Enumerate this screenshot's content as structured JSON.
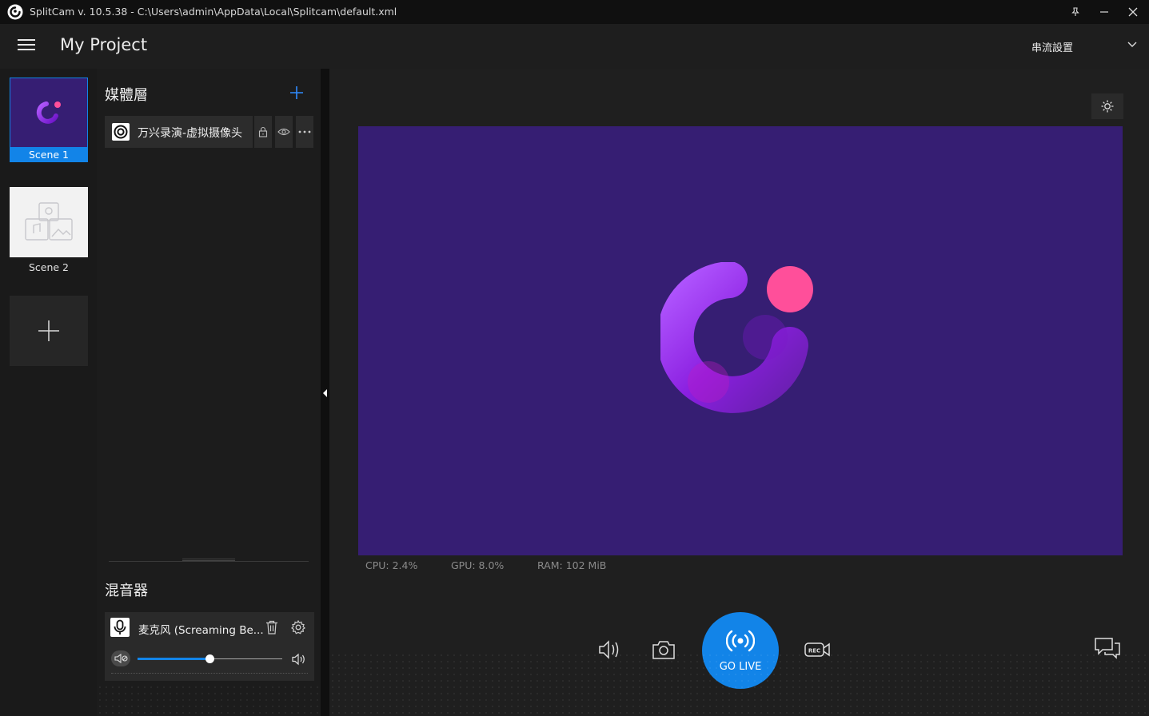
{
  "window": {
    "title": "SplitCam v. 10.5.38 - C:\\Users\\admin\\AppData\\Local\\Splitcam\\default.xml",
    "pin_icon": "pin-icon",
    "minimize_icon": "minimize-icon",
    "close_icon": "close-icon"
  },
  "header": {
    "project_name": "My Project",
    "stream_settings_label": "串流設置"
  },
  "scenes": [
    {
      "label": "Scene 1",
      "selected": true
    },
    {
      "label": "Scene 2",
      "selected": false
    }
  ],
  "sources": {
    "title": "媒體層",
    "items": [
      {
        "label": "万兴录演-虚拟摄像头"
      }
    ]
  },
  "mixer": {
    "title": "混音器",
    "items": [
      {
        "label": "麦克风 (Screaming  Be...",
        "volume_fraction": 0.58
      }
    ]
  },
  "stats": {
    "cpu": "CPU: 2.4%",
    "gpu": "GPU: 8.0%",
    "ram": "RAM: 102 MiB"
  },
  "controls": {
    "go_live_label": "GO LIVE"
  },
  "colors": {
    "accent": "#1284e8",
    "preview_bg": "#361e73",
    "scene_selected": "#1284e8"
  }
}
